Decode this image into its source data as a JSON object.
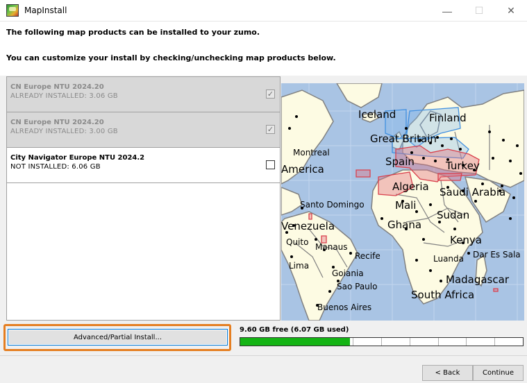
{
  "window": {
    "title": "MapInstall",
    "minimize": "—",
    "maximize": "☐",
    "close": "✕"
  },
  "header": {
    "line1": "The following map products can be installed to your zumo.",
    "line2": "You can customize your install by checking/unchecking map products below."
  },
  "products": [
    {
      "name": "CN Europe NTU 2024.20",
      "status": "ALREADY INSTALLED: 3.06 GB",
      "checked": true,
      "state": "installed"
    },
    {
      "name": "CN Europe NTU 2024.20",
      "status": "ALREADY INSTALLED: 3.00 GB",
      "checked": true,
      "state": "installed"
    },
    {
      "name": "City Navigator Europe NTU 2024.2",
      "status": "NOT INSTALLED: 6.06 GB",
      "checked": false,
      "state": "available"
    }
  ],
  "map": {
    "labels": {
      "iceland": "Iceland",
      "finland": "Finland",
      "great_britain": "Great Britain",
      "montreal": "Montreal",
      "spain": "Spain",
      "turkey": "Turkey",
      "america": "America",
      "algeria": "Algeria",
      "saudi_arabia": "Saudi Arabia",
      "santo_domingo": "Santo Domingo",
      "mali": "Mali",
      "sudan": "Sudan",
      "venezuela": "Venezuela",
      "ghana": "Ghana",
      "quito": "Quito",
      "manaus": "Manaus",
      "kenya": "Kenya",
      "recife": "Recife",
      "dar_es_sala": "Dar Es Sala",
      "lima": "Lima",
      "luanda": "Luanda",
      "goiania": "Goiania",
      "madagascar": "Madagascar",
      "sao_paulo": "Sao Paulo",
      "south_africa": "South Africa",
      "buenos_aires": "Buenos Aires"
    },
    "colors": {
      "ocean": "#a9c4e4",
      "land": "#fdfbe3",
      "border": "#808080",
      "installed_region": "#3f8fe0",
      "selected_region": "#d9404c"
    }
  },
  "footer": {
    "advanced_button": "Advanced/Partial Install...",
    "free_space": "9.60 GB free (6.07 GB used)",
    "used_fraction": 0.387,
    "back_button": "< Back",
    "continue_button": "Continue",
    "highlight_color": "#e57e21",
    "bar_color": "#14b414"
  }
}
